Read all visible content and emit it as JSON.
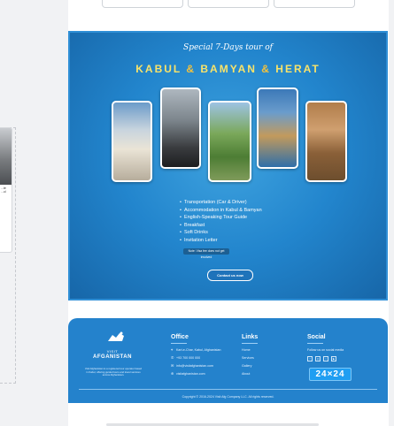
{
  "left_card": {
    "text": "...te ...ul"
  },
  "banner": {
    "subtitle": "Special 7-Days tour of",
    "city1": "KABUL",
    "amp1": "&",
    "city2": "BAMYAN",
    "amp2": "&",
    "city3": "HERAT",
    "bullets": [
      "Transportation (Car & Driver)",
      "Accommodation in Kabul & Bamyan",
      "English-Speaking Tour Guide",
      "Breakfast",
      "Soft Drinks",
      "Invitation Letter"
    ],
    "note": "Note: Visa fee does not get involved",
    "cta": "Contact us now"
  },
  "footer": {
    "brand_top": "VISIT",
    "brand_bottom": "AFGANISTAN",
    "about": "Visit Afghanistan is a registered tour operator based in Kabul, offering guided tours and travel services across Afghanistan.",
    "office": {
      "title": "Office",
      "address": "Kart-e-Char, Kabul, Afghanistan",
      "phone": "+93 700 000 000",
      "email": "info@visitafghanistan.com",
      "website": "visitafghanistan.com"
    },
    "links": {
      "title": "Links",
      "items": [
        "Home",
        "Services",
        "Gallery",
        "About"
      ]
    },
    "social": {
      "title": "Social",
      "follow": "Follow us on social media",
      "badge": "24×24"
    },
    "copyright": "Copyright © 2016-2024 Visit Afg Company LLC. All rights reserved."
  },
  "colors": {
    "banner_blue": "#2285cd",
    "footer_blue": "#2482cc",
    "accent_gold": "#f4c23c"
  }
}
